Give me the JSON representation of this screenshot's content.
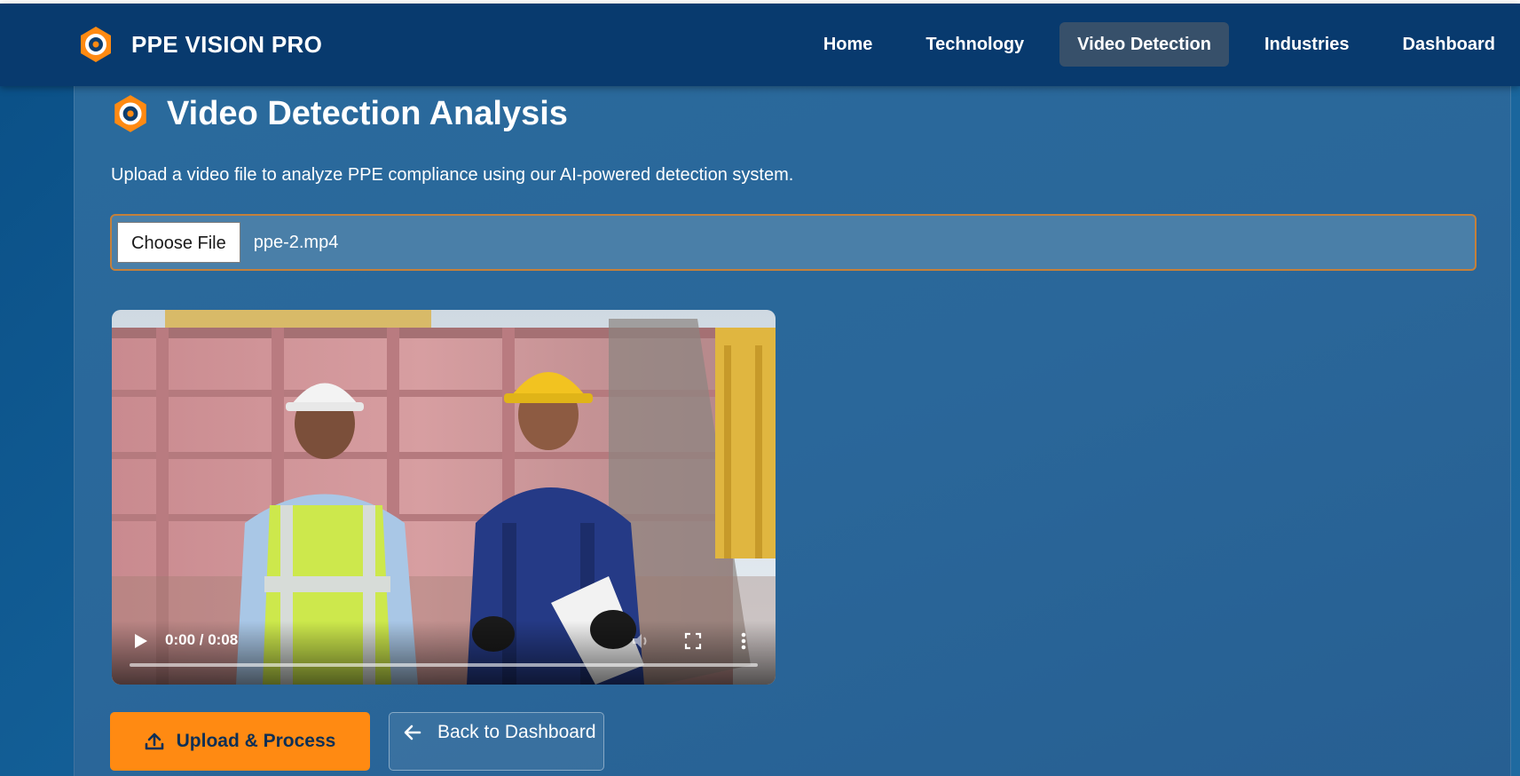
{
  "brand": {
    "name": "PPE VISION PRO",
    "logo_icon": "ppe-eye-logo-icon"
  },
  "nav": {
    "items": [
      {
        "label": "Home",
        "active": false
      },
      {
        "label": "Technology",
        "active": false
      },
      {
        "label": "Video Detection",
        "active": true
      },
      {
        "label": "Industries",
        "active": false
      },
      {
        "label": "Dashboard",
        "active": false
      }
    ]
  },
  "page": {
    "title": "Video Detection Analysis",
    "title_icon": "ppe-eye-logo-icon",
    "subtitle": "Upload a video file to analyze PPE compliance using our AI-powered detection system."
  },
  "file_input": {
    "button_label": "Choose File",
    "file_name": "ppe-2.mp4"
  },
  "video": {
    "time": "0:00 / 0:08",
    "progress": 0,
    "controls": [
      "play-icon",
      "mute-icon",
      "fullscreen-icon",
      "more-options-icon"
    ]
  },
  "actions": {
    "upload_label": "Upload & Process",
    "upload_icon": "upload-icon",
    "back_label": "Back to Dashboard",
    "back_icon": "arrow-left-icon"
  },
  "colors": {
    "navbar": "#083a6e",
    "accent_orange": "#ff8a12",
    "active_nav": "#37506a",
    "panel": "#2a679a"
  }
}
